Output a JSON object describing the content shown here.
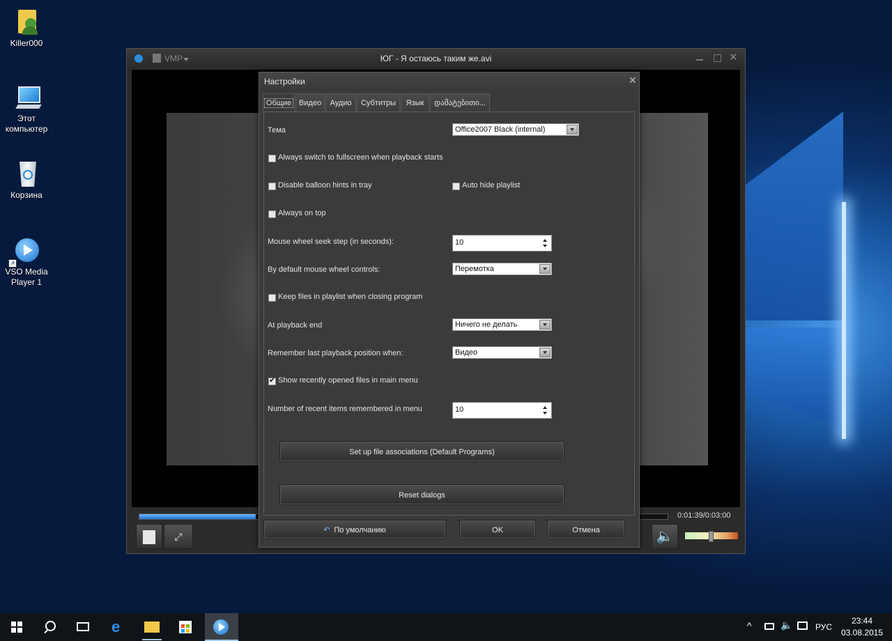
{
  "desktop": {
    "icons": [
      {
        "label": "Killer000"
      },
      {
        "label": "Этот компьютер"
      },
      {
        "label": "Корзина"
      },
      {
        "label": "VSO Media Player 1"
      }
    ]
  },
  "player": {
    "menu_label": "VMP",
    "title": "ЮГ - Я остаюсь таким же.avi",
    "time": "0:01:39/0:03:00",
    "seek_progress": 0.22
  },
  "dialog": {
    "title": "Настройки",
    "tabs": [
      "Общие",
      "Видео",
      "Аудио",
      "Субтитры",
      "Язык",
      "დამატებითი..."
    ],
    "theme_label": "Тема",
    "theme_value": "Office2007 Black (internal)",
    "fullscreen_label": "Always switch to fullscreen when playback starts",
    "fullscreen_checked": false,
    "balloon_label": "Disable balloon hints in tray",
    "balloon_checked": false,
    "autohide_label": "Auto hide playlist",
    "autohide_checked": false,
    "ontop_label": "Always on top",
    "ontop_checked": false,
    "seek_step_label": "Mouse wheel seek step (in seconds):",
    "seek_step_value": "10",
    "wheel_label": "By default mouse wheel controls:",
    "wheel_value": "Перемотка",
    "keepfiles_label": "Keep files in playlist when closing program",
    "keepfiles_checked": false,
    "playend_label": "At playback end",
    "playend_value": "Ничего не делать",
    "remember_label": "Remember last playback position when:",
    "remember_value": "Видео",
    "recent_label": "Show recently opened files in main menu",
    "recent_checked": true,
    "recent_count_label": "Number of recent items remembered in menu",
    "recent_count_value": "10",
    "assoc_button": "Set up file associations (Default Programs)",
    "reset_button": "Reset dialogs",
    "default_button": "По умолчанию",
    "ok_button": "OK",
    "cancel_button": "Отмена"
  },
  "taskbar": {
    "lang": "РУС",
    "time": "23:44",
    "date": "03.08.2015"
  },
  "colors": {
    "accent": "#1e78d6",
    "taskbar": "#101418"
  }
}
